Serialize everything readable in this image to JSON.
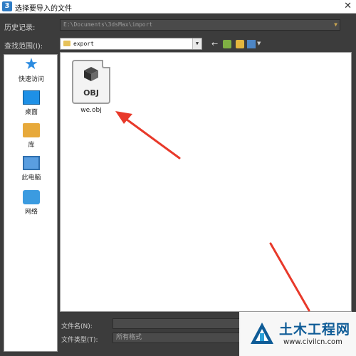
{
  "window": {
    "title": "选择要导入的文件",
    "close_glyph": "✕"
  },
  "history": {
    "label": "历史记录:",
    "value": "E:\\Documents\\3dsMax\\import",
    "arrow": "▼"
  },
  "look_in": {
    "label": "查找范围(I):",
    "value": "export",
    "arrow": "▼"
  },
  "toolbar": {
    "back_glyph": "←",
    "view_arrow": "▼",
    "icons": [
      "back-arrow-icon",
      "up-folder-icon",
      "new-folder-icon",
      "view-menu-icon"
    ]
  },
  "places": {
    "items": [
      {
        "label": "快速访问",
        "icon": "star-icon"
      },
      {
        "label": "桌面",
        "icon": "desktop-icon"
      },
      {
        "label": "库",
        "icon": "library-icon"
      },
      {
        "label": "此电脑",
        "icon": "computer-icon"
      },
      {
        "label": "网络",
        "icon": "network-icon"
      }
    ]
  },
  "files": [
    {
      "name": "we.obj",
      "icon_text": "OBJ",
      "icon": "obj-file-icon"
    }
  ],
  "file_name": {
    "label": "文件名(N):",
    "value": ""
  },
  "file_type": {
    "label": "文件类型(T):",
    "value": "所有格式"
  },
  "watermark": {
    "title": "土木工程网",
    "url": "www.civilcn.com"
  },
  "colors": {
    "dialog_bg": "#3c3c3c",
    "arrow": "#e8392a",
    "watermark_blue": "#0f5c97"
  }
}
